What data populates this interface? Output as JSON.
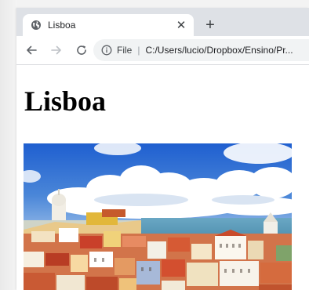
{
  "browser": {
    "tab": {
      "title": "Lisboa",
      "favicon": "globe-icon",
      "close_glyph": "✕"
    },
    "new_tab_glyph": "+",
    "toolbar": {
      "back": "back-arrow-icon",
      "forward": "forward-arrow-icon",
      "reload": "reload-icon",
      "info": "info-icon",
      "scheme_label": "File",
      "separator": "|",
      "url": "C:/Users/lucio/Dropbox/Ensino/Pr..."
    }
  },
  "page": {
    "heading": "Lisboa",
    "image": {
      "subject": "Lisbon skyline photo"
    }
  },
  "colors": {
    "tabstrip": "#dee1e6",
    "omnibox": "#f1f3f4",
    "sky": "#2f6fcf",
    "sea": "#5c9fbd"
  }
}
